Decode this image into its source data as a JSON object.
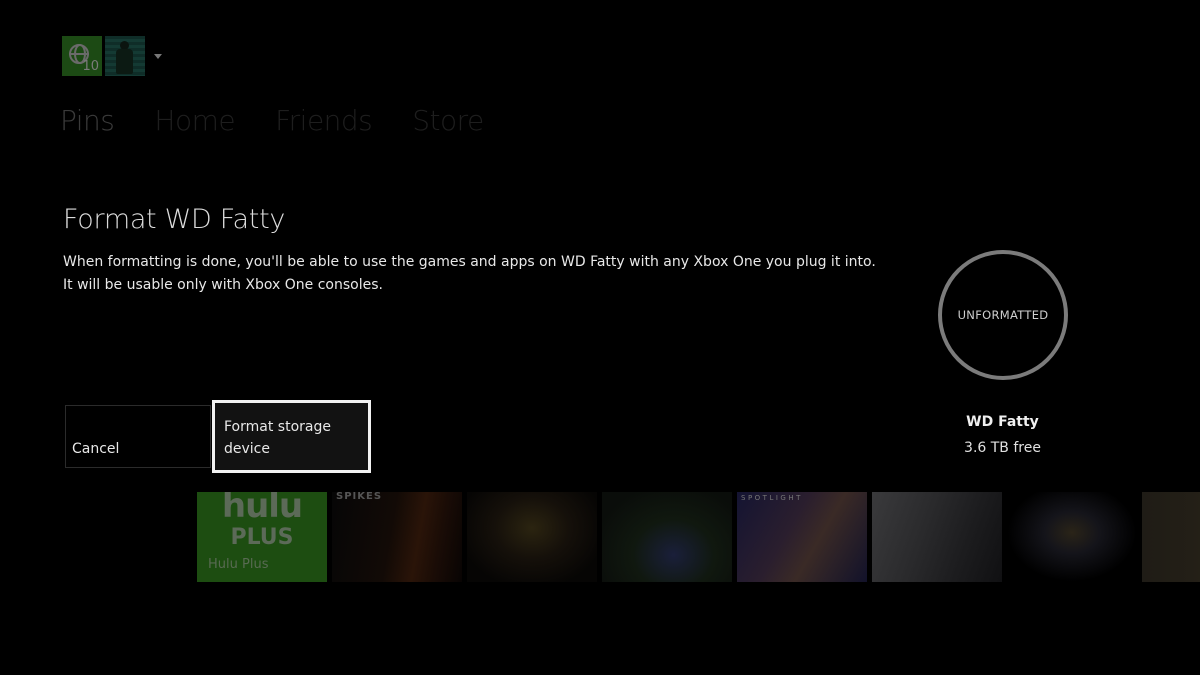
{
  "profile": {
    "gamerscore_icon": "globe-icon",
    "notification_count": "10",
    "avatar": "avatar-figure",
    "menu_icon": "caret-down-icon"
  },
  "nav": {
    "items": [
      {
        "label": "Pins"
      },
      {
        "label": "Home"
      },
      {
        "label": "Friends"
      },
      {
        "label": "Store"
      }
    ]
  },
  "dialog": {
    "title": "Format WD Fatty",
    "body": "When formatting is done, you'll be able to use the games and apps on WD Fatty with any Xbox One you plug it into. It will be usable only with Xbox One consoles.",
    "buttons": {
      "cancel": "Cancel",
      "format": "Format storage device"
    },
    "focused_button": "format"
  },
  "device": {
    "status": "UNFORMATTED",
    "name": "WD Fatty",
    "free_space": "3.6 TB free"
  },
  "tiles": [
    {
      "title": "Hulu Plus",
      "logo_text": "hulu",
      "logo_sub": "PLUS"
    },
    {
      "title": "game-tile",
      "caption": "SPIKES"
    },
    {
      "title": "game-tile"
    },
    {
      "title": "game-tile"
    },
    {
      "title": "spotlight-tile",
      "caption": "SPOTLIGHT"
    },
    {
      "title": "game-tile"
    },
    {
      "title": "halo-tile"
    },
    {
      "title": "game-tile"
    }
  ],
  "colors": {
    "background": "#000000",
    "xbox_green": "#1d4d11",
    "focus_border": "#f2f2f2",
    "ring": "#7b7b7b"
  }
}
